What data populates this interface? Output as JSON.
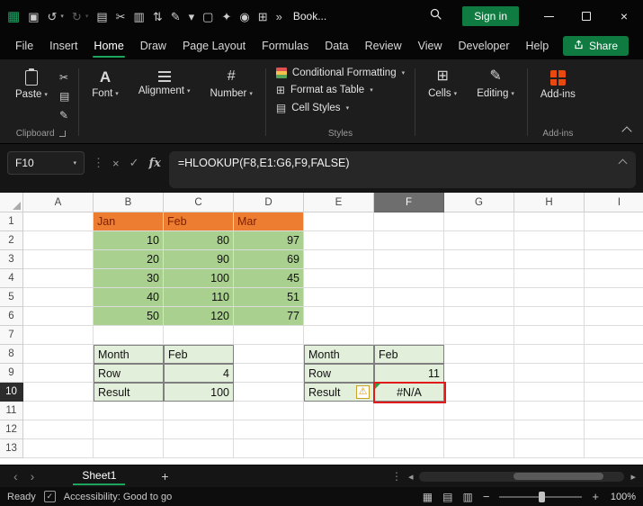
{
  "icons": {
    "caret": "▾",
    "close": "×",
    "cancel": "×",
    "enter": "✓",
    "dots": "⋮",
    "cut": "✂",
    "copy": "▤",
    "brush": "✎",
    "font": "A",
    "number": "#",
    "cells": "⊞",
    "editing": "✎",
    "format_table": "⊞",
    "cell_styles": "▤",
    "prev_sheet": "‹",
    "next_sheet": "›",
    "scroll_left": "◂",
    "scroll_right": "▸",
    "add_sheet": "+",
    "warning": "⚠",
    "view_normal": "▦",
    "view_layout": "▤",
    "view_break": "▥",
    "zoom_out": "−",
    "zoom_in": "+",
    "acc_check": "✓"
  },
  "titlebar": {
    "title": "Book...",
    "signin_label": "Sign in",
    "qat_icons": [
      {
        "name": "excel-logo-icon",
        "glyph": "▦",
        "green": true
      },
      {
        "name": "save-icon",
        "glyph": "▣"
      },
      {
        "name": "undo-icon",
        "glyph": "↺",
        "caret": true
      },
      {
        "name": "redo-icon",
        "glyph": "↻",
        "caret": true,
        "dim": true
      },
      {
        "name": "copy-icon",
        "glyph": "▤"
      },
      {
        "name": "cut-icon",
        "glyph": "✂"
      },
      {
        "name": "chart-icon",
        "glyph": "▥"
      },
      {
        "name": "sort-icon",
        "glyph": "⇅"
      },
      {
        "name": "draw-icon",
        "glyph": "✎"
      },
      {
        "name": "qat-dropdown-icon",
        "glyph": "▾"
      },
      {
        "name": "new-file-icon",
        "glyph": "▢"
      },
      {
        "name": "pin-icon",
        "glyph": "✦"
      },
      {
        "name": "camera-icon",
        "glyph": "◉"
      },
      {
        "name": "table-icon",
        "glyph": "⊞"
      },
      {
        "name": "overflow-icon",
        "glyph": "»"
      }
    ]
  },
  "menubar": {
    "items": [
      {
        "label": "File"
      },
      {
        "label": "Insert"
      },
      {
        "label": "Home",
        "active": true
      },
      {
        "label": "Draw"
      },
      {
        "label": "Page Layout"
      },
      {
        "label": "Formulas"
      },
      {
        "label": "Data"
      },
      {
        "label": "Review"
      },
      {
        "label": "View"
      },
      {
        "label": "Developer"
      },
      {
        "label": "Help"
      }
    ],
    "share_label": "Share"
  },
  "ribbon": {
    "paste_label": "Paste",
    "buttons": {
      "font": "Font",
      "alignment": "Alignment",
      "number": "Number",
      "cells": "Cells",
      "editing": "Editing",
      "addins": "Add-ins"
    },
    "styles_items": [
      "Conditional Formatting",
      "Format as Table",
      "Cell Styles"
    ],
    "group_labels": {
      "clipboard": "Clipboard",
      "styles": "Styles",
      "addins": "Add-ins"
    }
  },
  "formula_bar": {
    "name_box": "F10",
    "fx_label": "fx",
    "formula": "=HLOOKUP(F8,E1:G6,F9,FALSE)"
  },
  "grid": {
    "columns": [
      "A",
      "B",
      "C",
      "D",
      "E",
      "F",
      "G",
      "H",
      "I"
    ],
    "row_count": 13,
    "selected_column": "F",
    "selected_row": 10,
    "selected_cell": "F10",
    "colors": {
      "orange_fill": "#ED7D31",
      "green_fill": "#A9D08E",
      "table_fill": "#E2EFDA",
      "error_border_red": "#e11b1b"
    },
    "cells": [
      {
        "ref": "B1",
        "v": "Jan",
        "s": "o",
        "a": "l"
      },
      {
        "ref": "C1",
        "v": "Feb",
        "s": "o",
        "a": "l"
      },
      {
        "ref": "D1",
        "v": "Mar",
        "s": "o",
        "a": "l"
      },
      {
        "ref": "B2",
        "v": 10,
        "s": "g",
        "a": "r"
      },
      {
        "ref": "C2",
        "v": 80,
        "s": "g",
        "a": "r"
      },
      {
        "ref": "D2",
        "v": 97,
        "s": "g",
        "a": "r"
      },
      {
        "ref": "B3",
        "v": 20,
        "s": "g",
        "a": "r"
      },
      {
        "ref": "C3",
        "v": 90,
        "s": "g",
        "a": "r"
      },
      {
        "ref": "D3",
        "v": 69,
        "s": "g",
        "a": "r"
      },
      {
        "ref": "B4",
        "v": 30,
        "s": "g",
        "a": "r"
      },
      {
        "ref": "C4",
        "v": 100,
        "s": "g",
        "a": "r"
      },
      {
        "ref": "D4",
        "v": 45,
        "s": "g",
        "a": "r"
      },
      {
        "ref": "B5",
        "v": 40,
        "s": "g",
        "a": "r"
      },
      {
        "ref": "C5",
        "v": 110,
        "s": "g",
        "a": "r"
      },
      {
        "ref": "D5",
        "v": 51,
        "s": "g",
        "a": "r"
      },
      {
        "ref": "B6",
        "v": 50,
        "s": "g",
        "a": "r"
      },
      {
        "ref": "C6",
        "v": 120,
        "s": "g",
        "a": "r"
      },
      {
        "ref": "D6",
        "v": 77,
        "s": "g",
        "a": "r"
      },
      {
        "ref": "B8",
        "v": "Month",
        "s": "t",
        "a": "l"
      },
      {
        "ref": "C8",
        "v": "Feb",
        "s": "t",
        "a": "l"
      },
      {
        "ref": "B9",
        "v": "Row",
        "s": "t",
        "a": "l"
      },
      {
        "ref": "C9",
        "v": 4,
        "s": "t",
        "a": "r"
      },
      {
        "ref": "B10",
        "v": "Result",
        "s": "t",
        "a": "l"
      },
      {
        "ref": "C10",
        "v": 100,
        "s": "t",
        "a": "r"
      },
      {
        "ref": "E8",
        "v": "Month",
        "s": "t",
        "a": "l"
      },
      {
        "ref": "F8",
        "v": "Feb",
        "s": "t",
        "a": "l"
      },
      {
        "ref": "E9",
        "v": "Row",
        "s": "t",
        "a": "l"
      },
      {
        "ref": "F9",
        "v": 11,
        "s": "t",
        "a": "r"
      },
      {
        "ref": "E10",
        "v": "Result",
        "s": "t",
        "a": "l",
        "warn": true
      },
      {
        "ref": "F10",
        "v": "#N/A",
        "s": "t",
        "a": "c",
        "err": true
      }
    ]
  },
  "sheet_tabs": {
    "active_tab": "Sheet1"
  },
  "status_bar": {
    "ready_label": "Ready",
    "accessibility_label": "Accessibility: Good to go",
    "zoom_label": "100%"
  }
}
